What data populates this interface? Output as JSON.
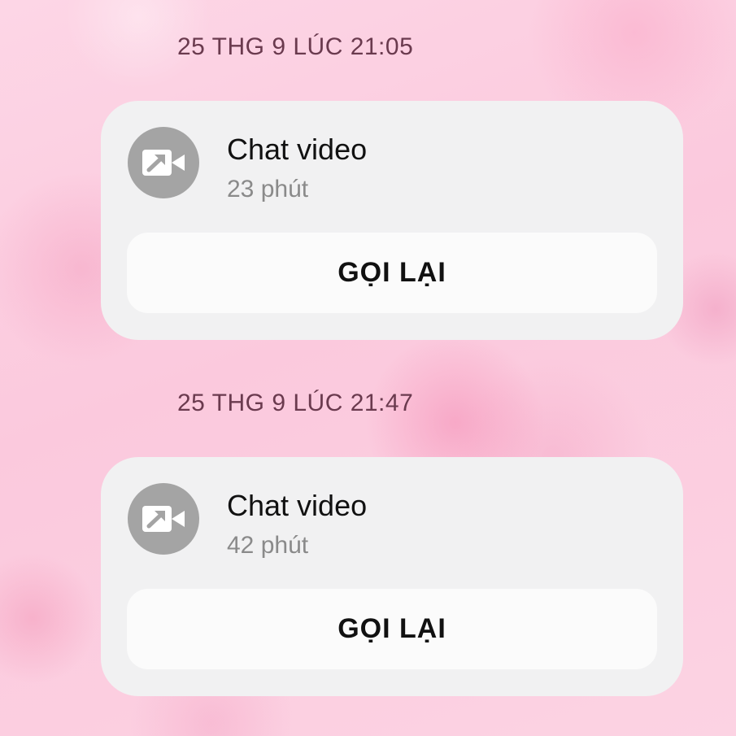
{
  "calls": [
    {
      "timestamp": "25 THG 9 LÚC 21:05",
      "title": "Chat video",
      "duration": "23 phút",
      "callback_label": "GỌI LẠI",
      "icon": "outgoing-video-call-icon"
    },
    {
      "timestamp": "25 THG 9 LÚC 21:47",
      "title": "Chat video",
      "duration": "42 phút",
      "callback_label": "GỌI LẠI",
      "icon": "outgoing-video-call-icon"
    }
  ],
  "colors": {
    "card_background": "#f1f1f2",
    "button_background": "#fbfbfb",
    "icon_circle": "#a4a4a4",
    "timestamp_text": "#6a3a4e"
  }
}
